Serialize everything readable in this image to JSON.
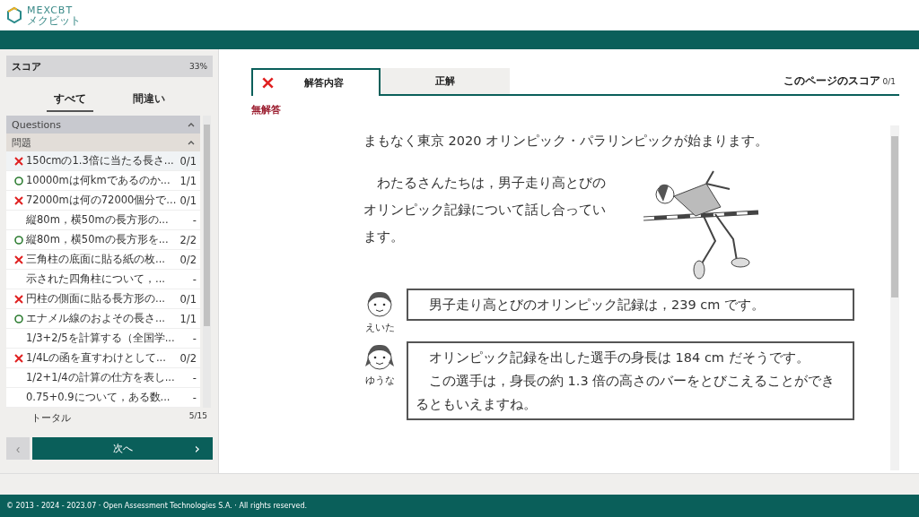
{
  "logo": {
    "name": "MEXCBT",
    "sub": "メクビット"
  },
  "sidebar": {
    "score": {
      "label": "スコア",
      "value": "33%"
    },
    "filters": [
      {
        "label": "すべて",
        "selected": true
      },
      {
        "label": "間違い",
        "selected": false
      }
    ],
    "section": {
      "title": "Questions",
      "expanded": true
    },
    "group": {
      "title": "問題",
      "expanded": true
    },
    "items": [
      {
        "kind": "wrong",
        "text": "150cmの1.3倍に当たる長さ...",
        "score": "0/1",
        "selected": true
      },
      {
        "kind": "correct",
        "text": "10000mは何kmであるのか...",
        "score": "1/1",
        "selected": false
      },
      {
        "kind": "wrong",
        "text": "72000mは何の72000個分で...",
        "score": "0/1",
        "selected": false
      },
      {
        "kind": "none",
        "text": "縦80m，横50mの長方形の...",
        "score": "-",
        "selected": false
      },
      {
        "kind": "correct",
        "text": "縦80m，横50mの長方形を...",
        "score": "2/2",
        "selected": false
      },
      {
        "kind": "wrong",
        "text": "三角柱の底面に貼る紙の枚...",
        "score": "0/2",
        "selected": false
      },
      {
        "kind": "none",
        "text": "示された四角柱について，...",
        "score": "-",
        "selected": false
      },
      {
        "kind": "wrong",
        "text": "円柱の側面に貼る長方形の...",
        "score": "0/1",
        "selected": false
      },
      {
        "kind": "correct",
        "text": "エナメル線のおよその長さ...",
        "score": "1/1",
        "selected": false
      },
      {
        "kind": "none",
        "text": "1/3+2/5を計算する（全国学...",
        "score": "-",
        "selected": false
      },
      {
        "kind": "wrong",
        "text": "1/4Lの函を直すわけとして...",
        "score": "0/2",
        "selected": false
      },
      {
        "kind": "none",
        "text": "1/2+1/4の計算の仕方を表し...",
        "score": "-",
        "selected": false
      },
      {
        "kind": "none",
        "text": "0.75+0.9について，ある数...",
        "score": "-",
        "selected": false
      }
    ],
    "total": {
      "label": "トータル",
      "value": "5/15"
    },
    "prev": {
      "label": "‹",
      "disabled": true
    },
    "next": {
      "label": "次へ",
      "arrow": "›"
    }
  },
  "main": {
    "tabs": [
      {
        "label": "解答内容",
        "selected": true,
        "kind": "wrong"
      },
      {
        "label": "正解",
        "selected": false
      }
    ],
    "page_score": {
      "label": "このページのスコア",
      "value": "0/1"
    },
    "status": "無解答",
    "question": {
      "intro": "まもなく東京 2020 オリンピック・パラリンピックが始まります。",
      "paragraph": "　わたるさんたちは，男子走り高とびのオリンピック記録について話し合っています。",
      "dialogs": [
        {
          "speaker": "えいた",
          "kind": "boy",
          "lines": [
            "　男子走り高とびのオリンピック記録は，239 cm です。"
          ]
        },
        {
          "speaker": "ゆうな",
          "kind": "girl",
          "lines": [
            "　オリンピック記録を出した選手の身長は 184 cm だそうです。",
            "　この選手は，身長の約 1.3 倍の高さのバーをとびこえることができるともいえますね。"
          ]
        }
      ]
    }
  },
  "footer": "© 2013 - 2024 - 2023.07 · Open Assessment Technologies S.A. · All rights reserved."
}
